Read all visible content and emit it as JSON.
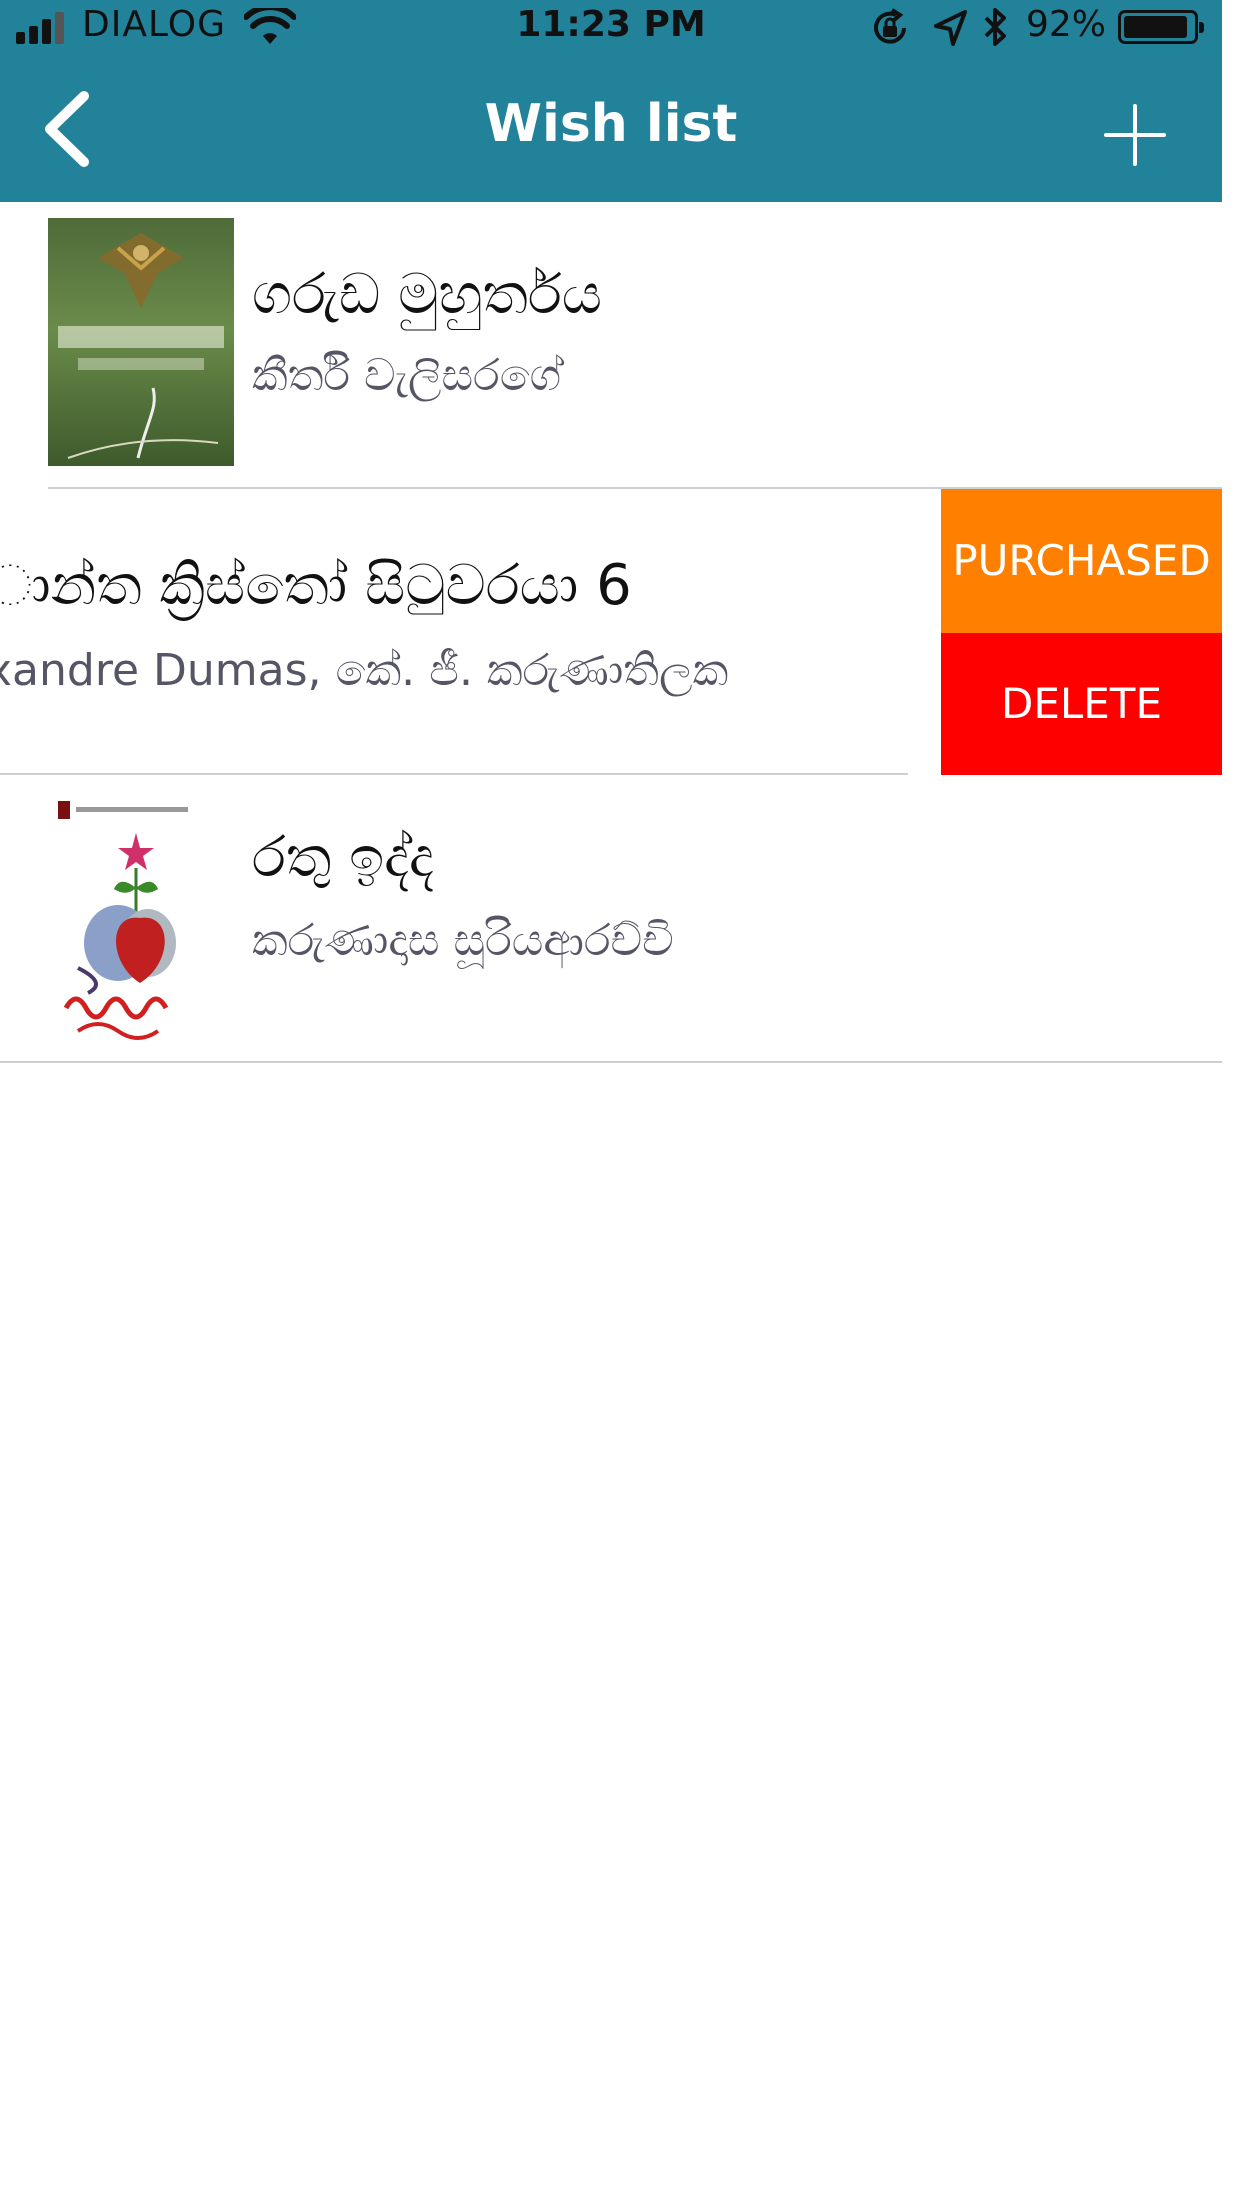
{
  "status_bar": {
    "carrier": "DIALOG",
    "time": "11:23 PM",
    "battery_percent": "92%",
    "battery_level": 0.92,
    "icons": [
      "signal-icon",
      "wifi-icon",
      "rotation-lock-icon",
      "location-icon",
      "bluetooth-icon",
      "battery-icon"
    ]
  },
  "nav": {
    "title": "Wish list",
    "back_icon": "chevron-left-icon",
    "add_icon": "plus-icon"
  },
  "books": [
    {
      "title": "ගරුඩ මුහුර්තය",
      "author": "කීර්ති වැලිසරගේ"
    },
    {
      "title": "ාන්ත ක්‍රිස්තෝ සිටුවරයා 6",
      "author": "xandre Dumas, කේ. ජී. කරුණාතිලක"
    },
    {
      "title": "රතු ඉද්ද",
      "author": "කරුණාදාස සූරියආරච්චි"
    }
  ],
  "swipe_actions": {
    "purchased_label": "PURCHASED",
    "delete_label": "DELETE"
  },
  "colors": {
    "header": "#22829a",
    "purchased": "#ff7f00",
    "delete": "#ff0000",
    "divider": "#cfcfcf"
  }
}
